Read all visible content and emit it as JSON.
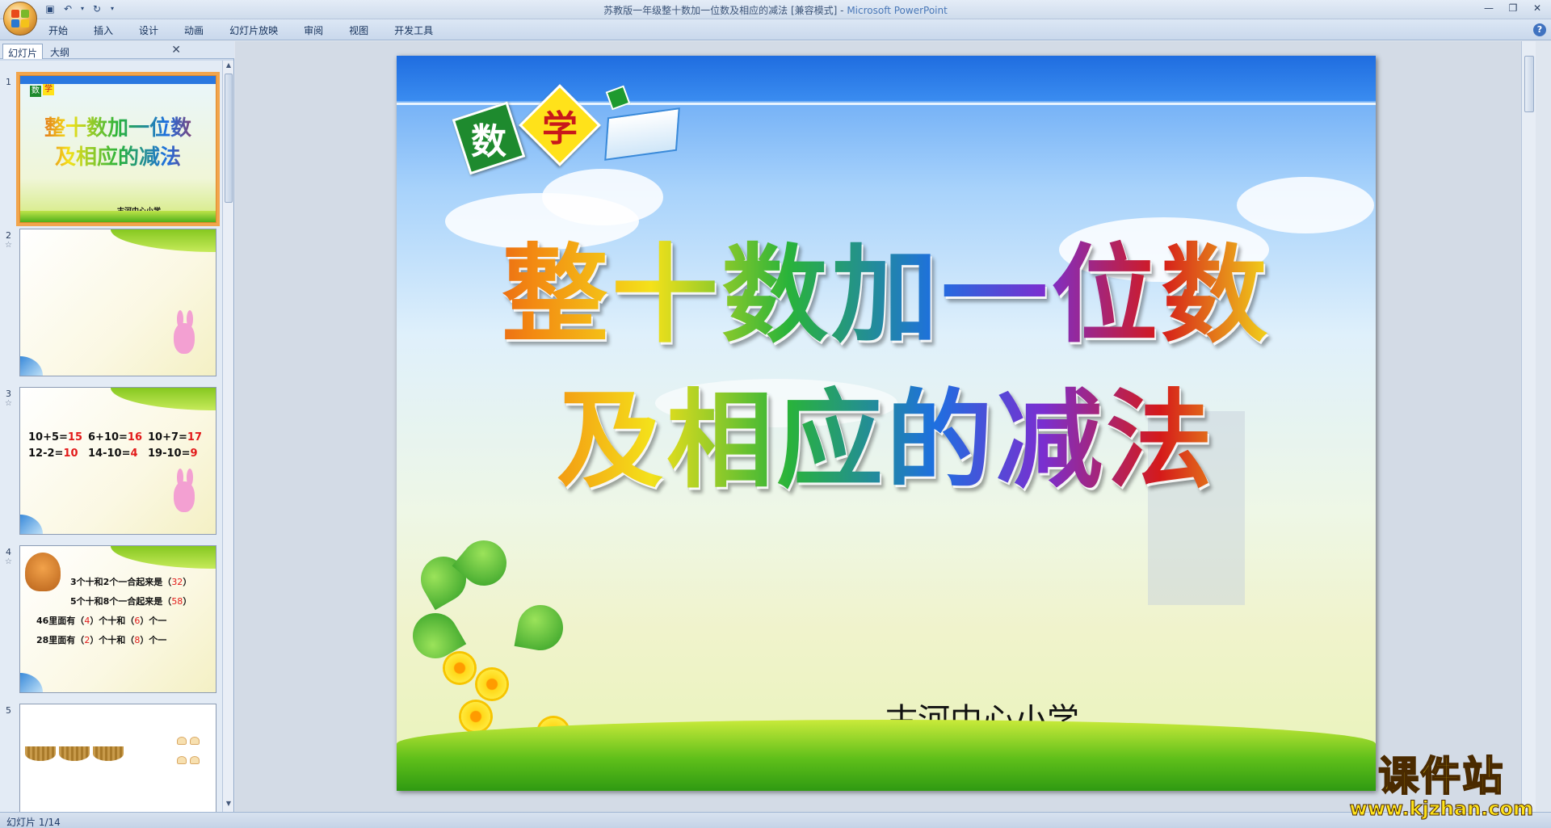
{
  "window": {
    "title_doc": "苏教版一年级整十数加一位数及相应的减法 [兼容模式] - ",
    "title_app": "Microsoft PowerPoint"
  },
  "ribbon": {
    "tabs": [
      "开始",
      "插入",
      "设计",
      "动画",
      "幻灯片放映",
      "审阅",
      "视图",
      "开发工具"
    ]
  },
  "panel": {
    "tab_slides": "幻灯片",
    "tab_outline": "大纲",
    "slides": [
      {
        "num": "1"
      },
      {
        "num": "2"
      },
      {
        "num": "3"
      },
      {
        "num": "4"
      },
      {
        "num": "5"
      }
    ]
  },
  "thumb1": {
    "badge1": "数",
    "badge2": "学",
    "line1": "整十数加一位数",
    "line2": "及相应的减法",
    "school": "古河中心小学"
  },
  "thumb3": {
    "row1": [
      {
        "expr": "10+5=",
        "ans": "15"
      },
      {
        "expr": "6+10=",
        "ans": "16"
      },
      {
        "expr": "10+7=",
        "ans": "17"
      }
    ],
    "row2": [
      {
        "expr": "12-2=",
        "ans": "10"
      },
      {
        "expr": "14-10=",
        "ans": "4"
      },
      {
        "expr": "19-10=",
        "ans": "9"
      }
    ]
  },
  "thumb4": {
    "l1_a": "3个十和2个一合起来是（",
    "l1_b": "32",
    "l1_c": "）",
    "l2_a": "5个十和8个一合起来是（",
    "l2_b": "58",
    "l2_c": "）",
    "l3_a": "46里面有（",
    "l3_b": "4",
    "l3_c": "）个十和（",
    "l3_d": "6",
    "l3_e": "）个一",
    "l4_a": "28里面有（",
    "l4_b": "2",
    "l4_c": "）个十和（",
    "l4_d": "8",
    "l4_e": "）个一"
  },
  "slide": {
    "badge1": "数",
    "badge2": "学",
    "line1": "整十数加一位数",
    "line2": "及相应的减法",
    "school": "古河中心小学"
  },
  "status": {
    "text": "幻灯片 1/14"
  },
  "watermark": {
    "cn": "课件站",
    "url": "www.kjzhan.com"
  },
  "colors": {
    "accent_orange": "#f2a54c",
    "answer_red": "#e21a1a",
    "slide_blue": "#1f6de0"
  }
}
